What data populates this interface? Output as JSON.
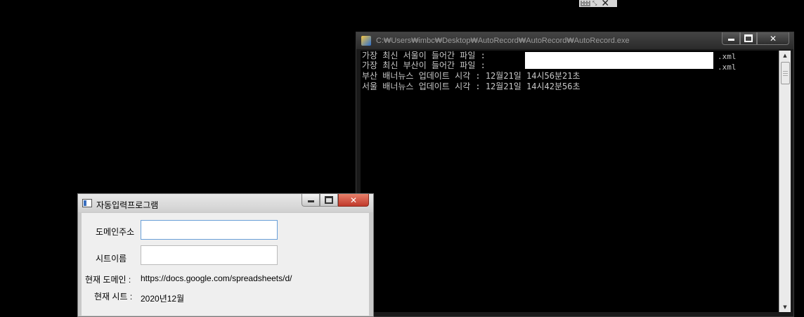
{
  "console": {
    "title": "C:₩Users₩imbc₩Desktop₩AutoRecord₩AutoRecord₩AutoRecord.exe",
    "lines": [
      {
        "label": "가장 최신 서울이 들어간 파일 :",
        "ext": ".xml"
      },
      {
        "label": "가장 최신 부산이 들어간 파일 :",
        "ext": ".xml"
      },
      {
        "label": "부산 배너뉴스 업데이트 시각 : 12월21일 14시56분21초"
      },
      {
        "label": "서울 배너뉴스 업데이트 시각 : 12월21일 14시42분56초"
      }
    ],
    "buttons": {
      "minimize": "minimize-icon",
      "maximize": "maximize-icon",
      "close": "✕"
    }
  },
  "form": {
    "title": "자동입력프로그램",
    "fields": {
      "domain_label": "도메인주소",
      "domain_value": "",
      "sheet_label": "시트이름",
      "sheet_value": ""
    },
    "current": {
      "domain_label": "현재 도메인 :",
      "domain_value": "https://docs.google.com/spreadsheets/d/",
      "sheet_label": "현재 시트 :",
      "sheet_value": "2020년12월"
    },
    "buttons": {
      "close": "✕"
    }
  }
}
